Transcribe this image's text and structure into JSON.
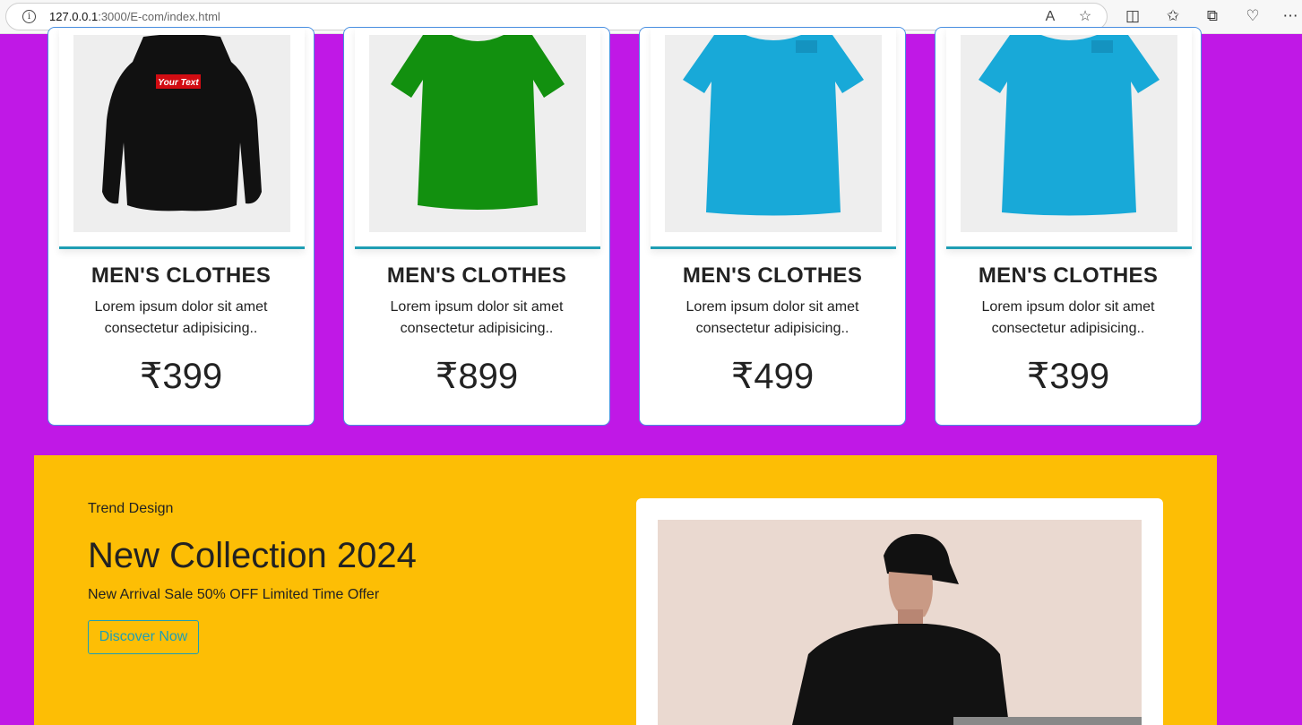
{
  "browser": {
    "url_host": "127.0.0.1",
    "url_path": ":3000/E-com/index.html"
  },
  "products": [
    {
      "title": "MEN'S CLOTHES",
      "desc": "Lorem ipsum dolor sit amet consectetur adipisicing..",
      "price": "₹399",
      "image": "black-hoodie"
    },
    {
      "title": "MEN'S CLOTHES",
      "desc": "Lorem ipsum dolor sit amet consectetur adipisicing..",
      "price": "₹899",
      "image": "green-tshirt"
    },
    {
      "title": "MEN'S CLOTHES",
      "desc": "Lorem ipsum dolor sit amet consectetur adipisicing..",
      "price": "₹499",
      "image": "blue-tshirt"
    },
    {
      "title": "MEN'S CLOTHES",
      "desc": "Lorem ipsum dolor sit amet consectetur adipisicing..",
      "price": "₹399",
      "image": "blue-tshirt"
    }
  ],
  "hoodie_print": "Your Text",
  "banner": {
    "eyebrow": "Trend Design",
    "headline": "New Collection 2024",
    "sub": "New Arrival Sale 50% OFF Limited Time Offer",
    "cta": "Discover Now"
  },
  "colors": {
    "page_bg": "#c018e6",
    "banner_bg": "#fdbe05",
    "accent": "#1f9eb4",
    "card_border": "#4a90e2"
  }
}
